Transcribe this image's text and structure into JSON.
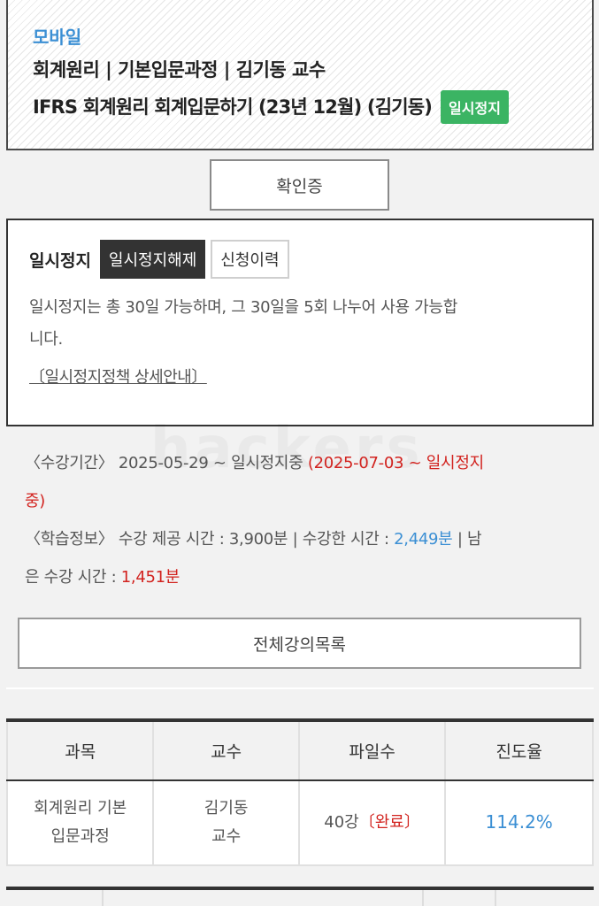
{
  "header": {
    "category": "모바일",
    "course_line": "회계원리 | 기본입문과정 | 김기동 교수",
    "title": "IFRS 회계원리 회계입문하기 (23년 12월) (김기동)",
    "status_badge": "일시정지",
    "badge_color": "#3bb463"
  },
  "confirm_button": "확인증",
  "pause": {
    "label": "일시정지",
    "tabs": [
      "일시정지해제",
      "신청이력"
    ],
    "description_1": "일시정지는 총 30일 가능하며, 그 30일을 5회 나누어 사용 가능합",
    "description_2": "니다.",
    "policy_link": "〔일시정지정책 상세안내〕"
  },
  "study_period": {
    "label": "〈수강기간〉",
    "value": "2025-05-29 ~ 일시정지중",
    "pause_range_1": "(2025-07-03 ~ 일시정지",
    "pause_range_2": "중)"
  },
  "study_info": {
    "label": "〈학습정보〉",
    "provided_label": "수강 제공 시간 :",
    "provided_value": "3,900분",
    "sep": "|",
    "taken_label": "수강한 시간 :",
    "taken_value": "2,449분",
    "remaining_label_1": "남",
    "remaining_label_2": "은 수강 시간 :",
    "remaining_value": "1,451분"
  },
  "all_lectures_button": "전체강의목록",
  "table": {
    "headers": [
      "과목",
      "교수",
      "파일수",
      "진도율"
    ],
    "row": {
      "subject_1": "회계원리 기본",
      "subject_2": "입문과정",
      "professor_1": "김기동",
      "professor_2": "교수",
      "files": "40강",
      "files_status": "〔완료〕",
      "progress": "114.2%"
    }
  },
  "colors": {
    "accent_blue": "#3b8fd4",
    "alert_red": "#d2231f"
  }
}
